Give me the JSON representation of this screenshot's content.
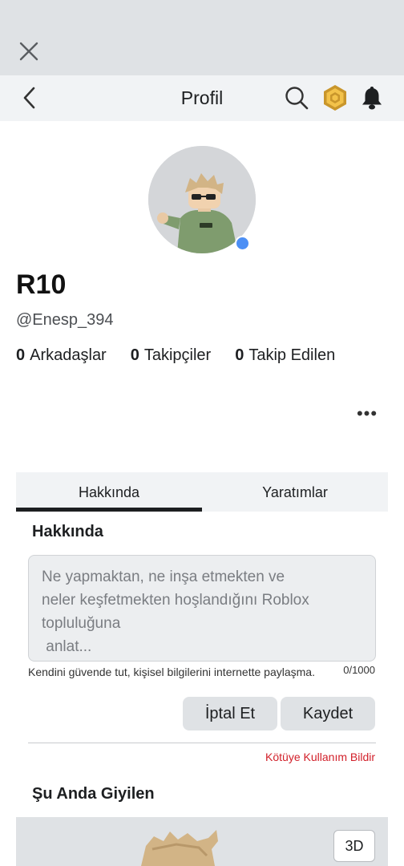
{
  "header": {
    "title": "Profil",
    "icons": [
      "close-icon",
      "chevron-left-icon",
      "search-icon",
      "robux-icon",
      "bell-icon"
    ]
  },
  "profile": {
    "display_name": "R10",
    "username": "@Enesp_394",
    "online_status_color": "#4c8ff5",
    "stats": [
      {
        "count": "0",
        "label": "Arkadaşlar"
      },
      {
        "count": "0",
        "label": "Takipçiler"
      },
      {
        "count": "0",
        "label": "Takip Edilen"
      }
    ],
    "more_label": "•••"
  },
  "tabs": [
    {
      "label": "Hakkında",
      "active": true
    },
    {
      "label": "Yaratımlar",
      "active": false
    }
  ],
  "about": {
    "title": "Hakkında",
    "placeholder": "Ne yapmaktan, ne inşa etmekten ve\nneler keşfetmekten hoşlandığını Roblox\ntopluluğuna\n anlat...",
    "privacy_hint": "Kendini güvende tut, kişisel bilgilerini internette paylaşma.",
    "char_count": "0/1000",
    "cancel_label": "İptal Et",
    "save_label": "Kaydet",
    "report_label": "Kötüye Kullanım Bildir"
  },
  "wearing": {
    "title": "Şu Anda Giyilen",
    "view_3d_label": "3D"
  },
  "colors": {
    "accent_online": "#4c8ff5",
    "report_red": "#d2202a",
    "chrome_gray": "#dfe2e5"
  }
}
